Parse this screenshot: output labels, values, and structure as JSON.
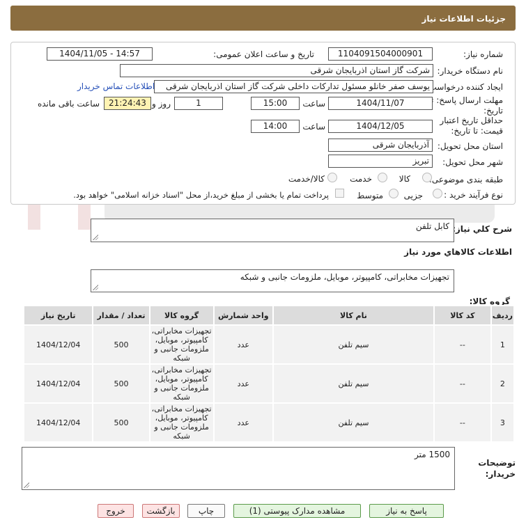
{
  "header": {
    "title": "جزئیات اطلاعات نیاز"
  },
  "form": {
    "need_number_label": "شماره نیاز:",
    "need_number": "1104091504000901",
    "announce_label": "تاریخ و ساعت اعلان عمومی:",
    "announce_value": "1404/11/05 - 14:57",
    "buyer_label": "نام دستگاه خریدار:",
    "buyer_value": "شرکت گاز استان اذربایجان شرقی",
    "creator_label": "ایجاد کننده درخواست:",
    "creator_value": "یوسف صفر خانلو  مسئول تدارکات داخلی  شرکت گاز استان اذربایجان شرقی",
    "contact_link": "اطلاعات تماس خریدار",
    "deadline_label_1": "مهلت ارسال پاسخ: تا",
    "deadline_label_2": "تاریخ:",
    "deadline_date": "1404/11/07",
    "hour_label": "ساعت",
    "deadline_time": "15:00",
    "days_value": "1",
    "days_label": "روز و",
    "remaining_value": "21:24:43",
    "remaining_label": "ساعت باقی مانده",
    "validity_label_1": "حداقل تاریخ اعتبار",
    "validity_label_2": "قیمت: تا تاریخ:",
    "validity_date": "1404/12/05",
    "validity_time": "14:00",
    "province_label": "استان محل تحویل:",
    "province_value": "آذربایجان شرقی",
    "city_label": "شهر محل تحویل:",
    "city_value": "تبریز",
    "category_label": "طبقه بندی موضوعی:",
    "category_options": [
      "کالا",
      "خدمت",
      "کالا/خدمت"
    ],
    "process_label": "نوع فرآیند خرید :",
    "process_options": [
      "جزیی",
      "متوسط"
    ],
    "payment_note": "پرداخت تمام یا بخشی از مبلغ خرید،از محل \"اسناد خزانه اسلامی\" خواهد بود."
  },
  "description": {
    "label": "شرح کلي نياز:",
    "value": "کابل تلفن"
  },
  "goods": {
    "section_title": "اطلاعات کالاهاي مورد نياز",
    "group_label": "گروه کالا:",
    "group_value": "تجهیزات مخابراتی، کامپیوتر، موبایل، ملزومات جانبی و شبکه",
    "columns": [
      "ردیف",
      "کد کالا",
      "نام کالا",
      "واحد شمارش",
      "گروه کالا",
      "تعداد / مقدار",
      "تاریخ نیاز"
    ],
    "rows": [
      {
        "index": "1",
        "code": "--",
        "name": "سیم تلفن",
        "unit": "عدد",
        "group": "تجهیزات مخابراتی، کامپیوتر، موبایل، ملزومات جانبی و شبکه",
        "qty": "500",
        "date": "1404/12/04"
      },
      {
        "index": "2",
        "code": "--",
        "name": "سیم تلفن",
        "unit": "عدد",
        "group": "تجهیزات مخابراتی، کامپیوتر، موبایل، ملزومات جانبی و شبکه",
        "qty": "500",
        "date": "1404/12/04"
      },
      {
        "index": "3",
        "code": "--",
        "name": "سیم تلفن",
        "unit": "عدد",
        "group": "تجهیزات مخابراتی، کامپیوتر، موبایل، ملزومات جانبی و شبکه",
        "qty": "500",
        "date": "1404/12/04"
      }
    ]
  },
  "buyer_notes": {
    "label_1": "توضیحات",
    "label_2": "خریدار:",
    "value": "1500 متر"
  },
  "buttons": {
    "respond": "پاسخ به نیاز",
    "attachments": "مشاهده مدارک پیوستی (1)",
    "print": "چاپ",
    "back": "بازگشت",
    "exit": "خروج"
  },
  "colors": {
    "header_bg": "#8b6d3f",
    "remaining_bg": "#fff3b3",
    "link": "#2650b8"
  }
}
